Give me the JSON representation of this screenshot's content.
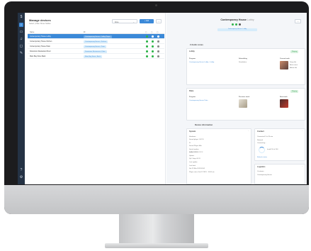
{
  "nav": {
    "icons": [
      "logo-icon",
      "home-icon",
      "devices-icon",
      "music-icon",
      "chat-icon",
      "wrench-icon"
    ],
    "bottom_icons": [
      "help-icon",
      "gear-icon"
    ]
  },
  "left": {
    "title": "Manage devices",
    "subtitle": "Select | Filter    Show hidden",
    "select_value": "Zone",
    "add_label": "+ Add",
    "columns": [
      "Name",
      "ID",
      "",
      "",
      ""
    ],
    "rows": [
      {
        "name": "Contemporary House Lobby",
        "pill": "Contemporary House • Lobby Player",
        "selected": true,
        "dots": [
          "#2fb34a",
          "#ffffff",
          "#ffffff"
        ]
      },
      {
        "name": "Contemporary House Kitchen",
        "pill": "Contemporary House • Kitchen",
        "selected": false,
        "dots": [
          "#2fb34a",
          "#2fb34a",
          "#888888"
        ]
      },
      {
        "name": "Contemporary House Patio",
        "pill": "Contemporary House • Patio",
        "selected": false,
        "dots": [
          "#2fb34a",
          "#2fb34a",
          "#888888"
        ]
      },
      {
        "name": "Downtown Restaurant Floor",
        "pill": "Downtown Restaurant • Floor",
        "selected": false,
        "dots": [
          "#2fb34a",
          "#2fb34a",
          "#888888"
        ]
      },
      {
        "name": "Main Bay Store Back",
        "pill": "Main Bay Store • Back",
        "selected": false,
        "dots": [
          "#2fb34a",
          "#2fb34a",
          "#888888"
        ]
      }
    ]
  },
  "right": {
    "title": "Contemporary House",
    "title_suffix": "Lobby",
    "chip": "Contemporary House • Lobby",
    "audio_zones_label": "2 Audio zones",
    "lobby": {
      "title": "Lobby",
      "status": "Playing",
      "program_label": "Program",
      "program_value": "Contemporary House Lobby - Lobby",
      "scheduling_label": "Scheduling",
      "scheduling_value": "Standalone",
      "current_label": "Current track",
      "track_lines": [
        "Song title",
        "Artist name",
        "Album title"
      ]
    },
    "patio": {
      "title": "Patio",
      "status": "Playing",
      "program_label": "Program",
      "program_value": "Contemporary House Patio",
      "prev_label": "Previous track",
      "next_label": "Next track"
    },
    "device_info_label": "Device information",
    "system": {
      "title": "System",
      "lines": [
        "Hardware",
        "Sound player 1.02.11",
        "Pi",
        "Sound Player Mini",
        "Serial number",
        "AAAA-BBBB-CCCC",
        "Uptime",
        "Up 2 days 04:11",
        "Last update",
        "Last boot",
        "Sat 23 Mar 2019 09:41",
        "Player since Jan 01 2019 · 10:00 am"
      ]
    },
    "connection": {
      "title": "Contact",
      "lines": [
        "Connected 1 hr 20 min",
        "Network",
        "Connecting...",
        "Install 10 of 100"
      ],
      "refresh_label": "Refresh status"
    },
    "logistics": {
      "title": "Logistics",
      "lines": [
        "Customer",
        "Contemporary House"
      ]
    }
  },
  "colors": {
    "accent": "#3b89d8",
    "nav_bg": "#243244",
    "ok": "#2fb34a",
    "bezel": "#1c1c1e",
    "aluminum": "#d6d7d9"
  }
}
